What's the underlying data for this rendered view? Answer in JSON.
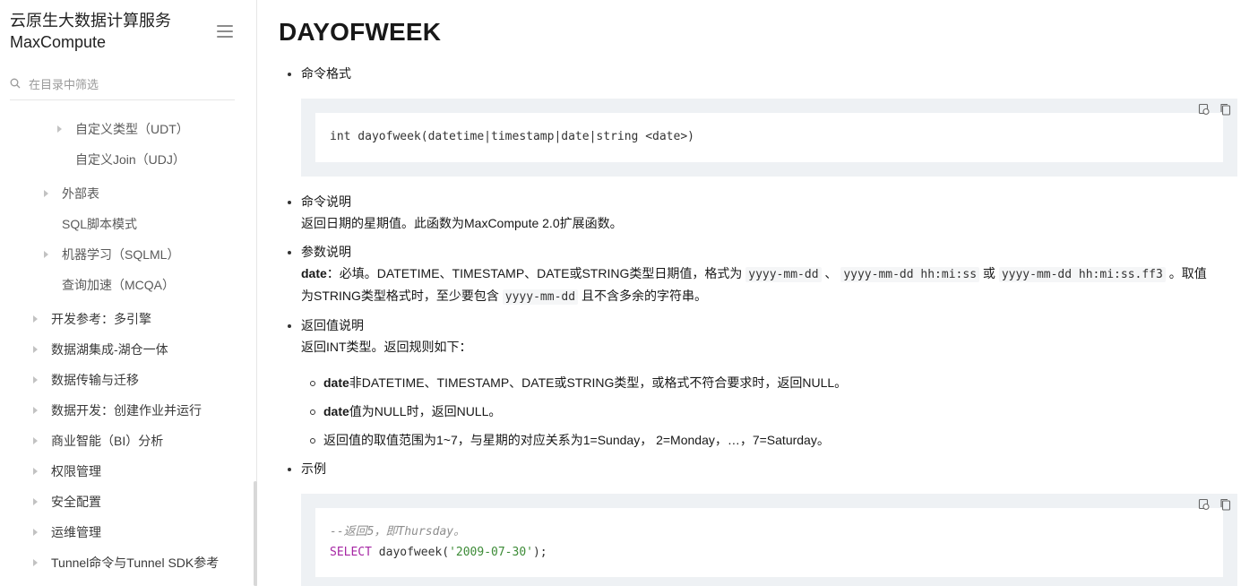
{
  "sidebar": {
    "brand_line1": "云原生大数据计算服务",
    "brand_line2": "MaxCompute",
    "filter_placeholder": "在目录中筛选",
    "items": [
      {
        "label": "自定义类型（UDT）"
      },
      {
        "label": "自定义Join（UDJ）"
      },
      {
        "label": "外部表"
      },
      {
        "label": "SQL脚本模式"
      },
      {
        "label": "机器学习（SQLML）"
      },
      {
        "label": "查询加速（MCQA）"
      },
      {
        "label": "开发参考：多引擎"
      },
      {
        "label": "数据湖集成-湖仓一体"
      },
      {
        "label": "数据传输与迁移"
      },
      {
        "label": "数据开发：创建作业并运行"
      },
      {
        "label": "商业智能（BI）分析"
      },
      {
        "label": "权限管理"
      },
      {
        "label": "安全配置"
      },
      {
        "label": "运维管理"
      },
      {
        "label": "Tunnel命令与Tunnel SDK参考"
      }
    ]
  },
  "article": {
    "title": "DAYOFWEEK",
    "section_syntax": "命令格式",
    "syntax_code": "int dayofweek(datetime|timestamp|date|string <date>)",
    "section_desc": "命令说明",
    "desc_text": "返回日期的星期值。此函数为MaxCompute 2.0扩展函数。",
    "section_params": "参数说明",
    "param_name": "date",
    "param_text1": "：必填。DATETIME、TIMESTAMP、DATE或STRING类型日期值，格式为",
    "fmt1": "yyyy-mm-dd",
    "sep1": "、",
    "fmt2": "yyyy-mm-dd hh:mi:ss",
    "sep2": "或",
    "fmt3": "yyyy-mm-dd hh:mi:ss.ff3",
    "param_text2": "。取值",
    "param_text3": "为STRING类型格式时，至少要包含",
    "fmt4": "yyyy-mm-dd",
    "param_text4": "且不含多余的字符串。",
    "section_return": "返回值说明",
    "return_text": "返回INT类型。返回规则如下：",
    "rule1_bold": "date",
    "rule1_text": "非DATETIME、TIMESTAMP、DATE或STRING类型，或格式不符合要求时，返回NULL。",
    "rule2_bold": "date",
    "rule2_text": "值为NULL时，返回NULL。",
    "rule3_text": "返回值的取值范围为1~7，与星期的对应关系为1=Sunday， 2=Monday，…，7=Saturday。",
    "section_example": "示例",
    "example_comment": "--返回5，即Thursday。",
    "example_keyword": "SELECT",
    "example_func": " dayofweek(",
    "example_string": "'2009-07-30'",
    "example_end": ");"
  },
  "icons": {
    "menu": "hamburger-menu-icon",
    "filter": "search-icon",
    "caret": "caret-right-icon",
    "run": "run-code-icon",
    "copy": "copy-icon"
  }
}
